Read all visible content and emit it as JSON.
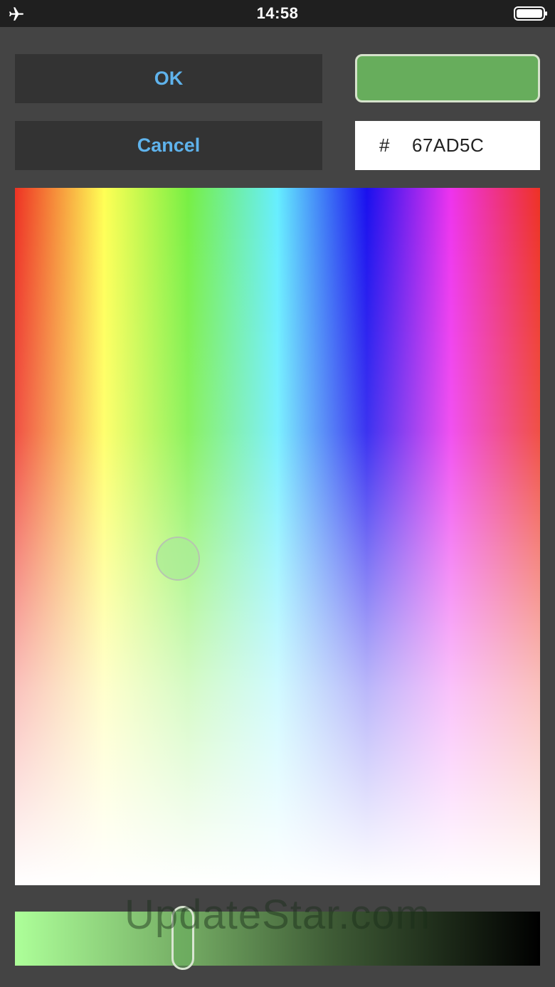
{
  "status_bar": {
    "time": "14:58",
    "left_icon": "airplane-icon",
    "right_icon": "battery-icon"
  },
  "buttons": {
    "ok_label": "OK",
    "cancel_label": "Cancel"
  },
  "color": {
    "hash_symbol": "#",
    "hex_value": "67AD5C",
    "preview_hex": "#67AD5C"
  },
  "theme": {
    "background": "#444444",
    "button_bg": "#333333",
    "button_text": "#5FB3EC",
    "status_bar_bg": "#1F1F1F"
  },
  "brightness": {
    "level": 0.32
  },
  "watermark": "UpdateStar.com"
}
